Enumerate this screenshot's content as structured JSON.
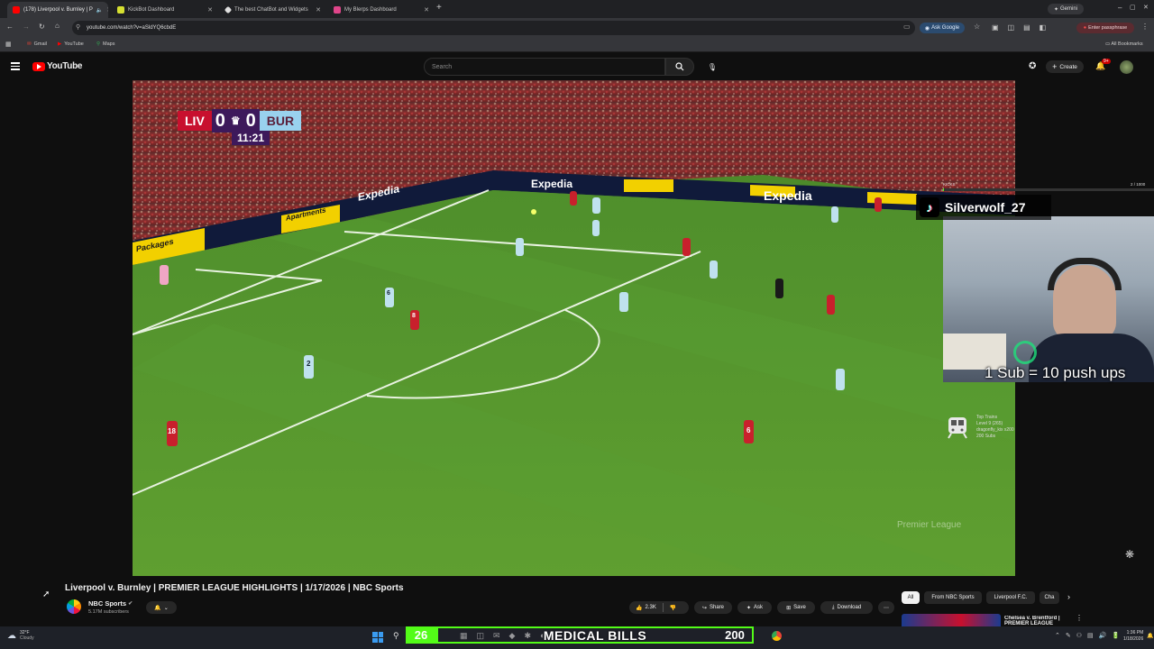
{
  "browser": {
    "tabs": [
      {
        "title": "(178) Liverpool v. Burnley | P",
        "active": true,
        "favicon_color": "#ff0000"
      },
      {
        "title": "KickBot Dashboard",
        "active": false,
        "favicon_color": "#d6e031"
      },
      {
        "title": "The best ChatBot and Widgets",
        "active": false,
        "favicon_color": "#e0e0e0"
      },
      {
        "title": "My Blerps Dashboard",
        "active": false,
        "favicon_color": "#e0458a"
      }
    ],
    "gemini_label": "Gemini",
    "url": "youtube.com/watch?v=aSldYQ6cbdE",
    "ask_google": "Ask Google",
    "enter_passphrase": "Enter passphrase",
    "bookmarks": [
      "Gmail",
      "YouTube",
      "Maps"
    ],
    "all_bookmarks": "All Bookmarks"
  },
  "youtube": {
    "logo_text": "YouTube",
    "search_placeholder": "Search",
    "create_label": "Create",
    "notifications_badge": "9+"
  },
  "video": {
    "scoreboard": {
      "home": "LIV",
      "home_score": "0",
      "away_score": "0",
      "away": "BUR",
      "clock": "11:21"
    },
    "watermark": "Premier League",
    "ads": [
      "Expedia",
      "Expedia",
      "Expedia",
      "Apartments",
      "Packages"
    ],
    "players": [
      "6",
      "8",
      "2",
      "18",
      "6"
    ]
  },
  "stream_overlay": {
    "kicks_label": "KICKS",
    "kicks_count": "2 / 1000",
    "username": "Silverwolf_27",
    "goal_text": "1 Sub = 10 push ups",
    "train_lines": [
      "Top Trains",
      "Level 9 (265)",
      "dragonfly_kix x200",
      "200 Subs"
    ]
  },
  "video_info": {
    "title": "Liverpool v. Burnley | PREMIER LEAGUE HIGHLIGHTS | 1/17/2026 | NBC Sports",
    "channel": "NBC Sports",
    "subscribers": "5.17M subscribers",
    "likes": "2.3K",
    "share": "Share",
    "ask": "Ask",
    "save": "Save",
    "download": "Download"
  },
  "recommendations": {
    "chips": [
      "All",
      "From NBC Sports",
      "Liverpool F.C.",
      "Cha"
    ],
    "first_item_title": "Chelsea v. Brentford | PREMIER LEAGUE"
  },
  "taskbar": {
    "weather_temp": "32°F",
    "weather_desc": "Cloudy",
    "counter_left": "26",
    "ticker_text": "MEDICAL BILLS",
    "counter_right": "200",
    "time": "1:36 PM",
    "date": "1/18/2026"
  }
}
